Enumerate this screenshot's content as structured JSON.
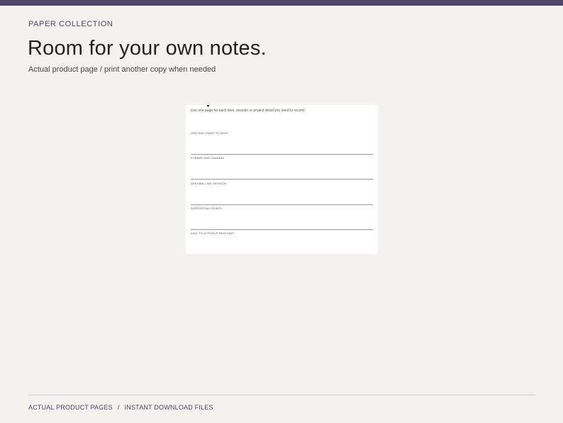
{
  "header": {
    "eyebrow": "PAPER COLLECTION",
    "headline": "Room for your own notes.",
    "subline": "Actual product page / print another copy when needed"
  },
  "sheet": {
    "intro": "Use one page for each item, session or project detail you need to record.",
    "fields": [
      {
        "label": "ORIGINAL POINT TO KEEP"
      },
      {
        "label": "FORMAT AND CHANNEL"
      },
      {
        "label": "OPENING LINE OR HOOK"
      },
      {
        "label": "SUPPORTING POINTS"
      },
      {
        "label": "CALL TO ACTION IF RELEVANT"
      }
    ]
  },
  "footer": {
    "link_1": "ACTUAL PRODUCT PAGES",
    "separator": "/",
    "link_2": "INSTANT DOWNLOAD FILES"
  },
  "colors": {
    "top_bar": "#4f4768",
    "background": "#f3f2ee",
    "accent_text": "#4a4560"
  }
}
